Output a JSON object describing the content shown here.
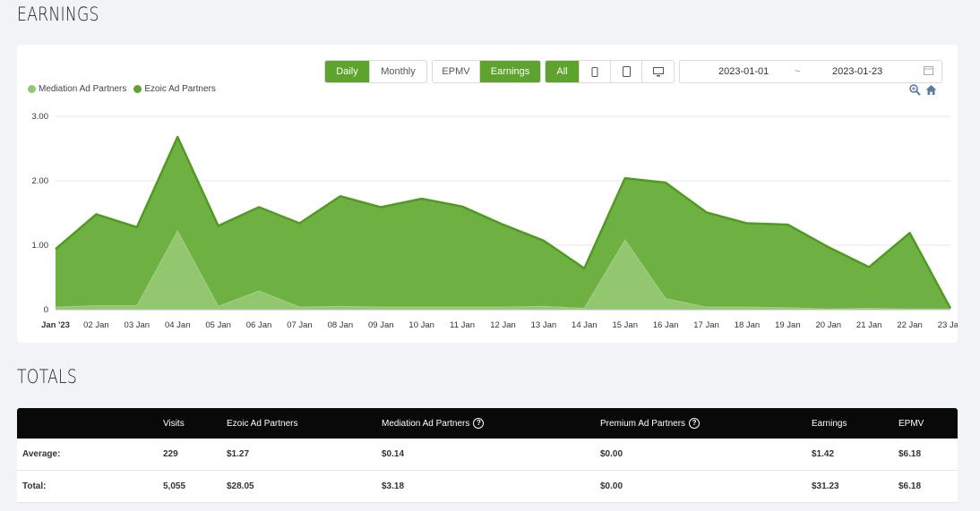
{
  "earnings_title": "EARNINGS",
  "totals_title": "TOTALS",
  "controls": {
    "period": [
      "Daily",
      "Monthly"
    ],
    "metric": [
      "EPMV",
      "Earnings"
    ],
    "device": [
      "All"
    ],
    "device_icons": [
      "mobile-icon",
      "tablet-icon",
      "desktop-icon"
    ],
    "date_start": "2023-01-01",
    "date_sep": "~",
    "date_end": "2023-01-23"
  },
  "colors": {
    "accent": "#5da32e",
    "ezoic_fill": "#6fb043",
    "ezoic_stroke": "#4f9a22",
    "mediation_fill": "#93c872",
    "mediation_dot": "#93c872",
    "ezoic_dot": "#5da32e"
  },
  "chart_data": {
    "type": "area",
    "categories": [
      "Jan '23",
      "02 Jan",
      "03 Jan",
      "04 Jan",
      "05 Jan",
      "06 Jan",
      "07 Jan",
      "08 Jan",
      "09 Jan",
      "10 Jan",
      "11 Jan",
      "12 Jan",
      "13 Jan",
      "14 Jan",
      "15 Jan",
      "16 Jan",
      "17 Jan",
      "18 Jan",
      "19 Jan",
      "20 Jan",
      "21 Jan",
      "22 Jan",
      "23 Jan"
    ],
    "series": [
      {
        "name": "Mediation Ad Partners",
        "values": [
          0.04,
          0.06,
          0.06,
          1.22,
          0.05,
          0.29,
          0.04,
          0.05,
          0.04,
          0.04,
          0.04,
          0.04,
          0.05,
          0.02,
          1.08,
          0.17,
          0.04,
          0.04,
          0.03,
          0.01,
          0.02,
          0.01,
          0.01
        ]
      },
      {
        "name": "Ezoic Ad Partners",
        "values": [
          0.94,
          1.48,
          1.28,
          2.68,
          1.3,
          1.59,
          1.34,
          1.76,
          1.59,
          1.72,
          1.6,
          1.32,
          1.07,
          0.64,
          2.04,
          1.97,
          1.51,
          1.34,
          1.32,
          0.97,
          0.66,
          1.19,
          0.02
        ]
      }
    ],
    "yticks": [
      "0",
      "1.00",
      "2.00",
      "3.00"
    ],
    "ylim": [
      0,
      3
    ],
    "grid": true,
    "legend": "top-left"
  },
  "table": {
    "headers": [
      "Visits",
      "Ezoic Ad Partners",
      "Mediation Ad Partners",
      "Premium Ad Partners",
      "Earnings",
      "EPMV"
    ],
    "rows": [
      {
        "label": "Average:",
        "values": [
          "229",
          "$1.27",
          "$0.14",
          "$0.00",
          "$1.42",
          "$6.18"
        ]
      },
      {
        "label": "Total:",
        "values": [
          "5,055",
          "$28.05",
          "$3.18",
          "$0.00",
          "$31.23",
          "$6.18"
        ]
      }
    ]
  }
}
